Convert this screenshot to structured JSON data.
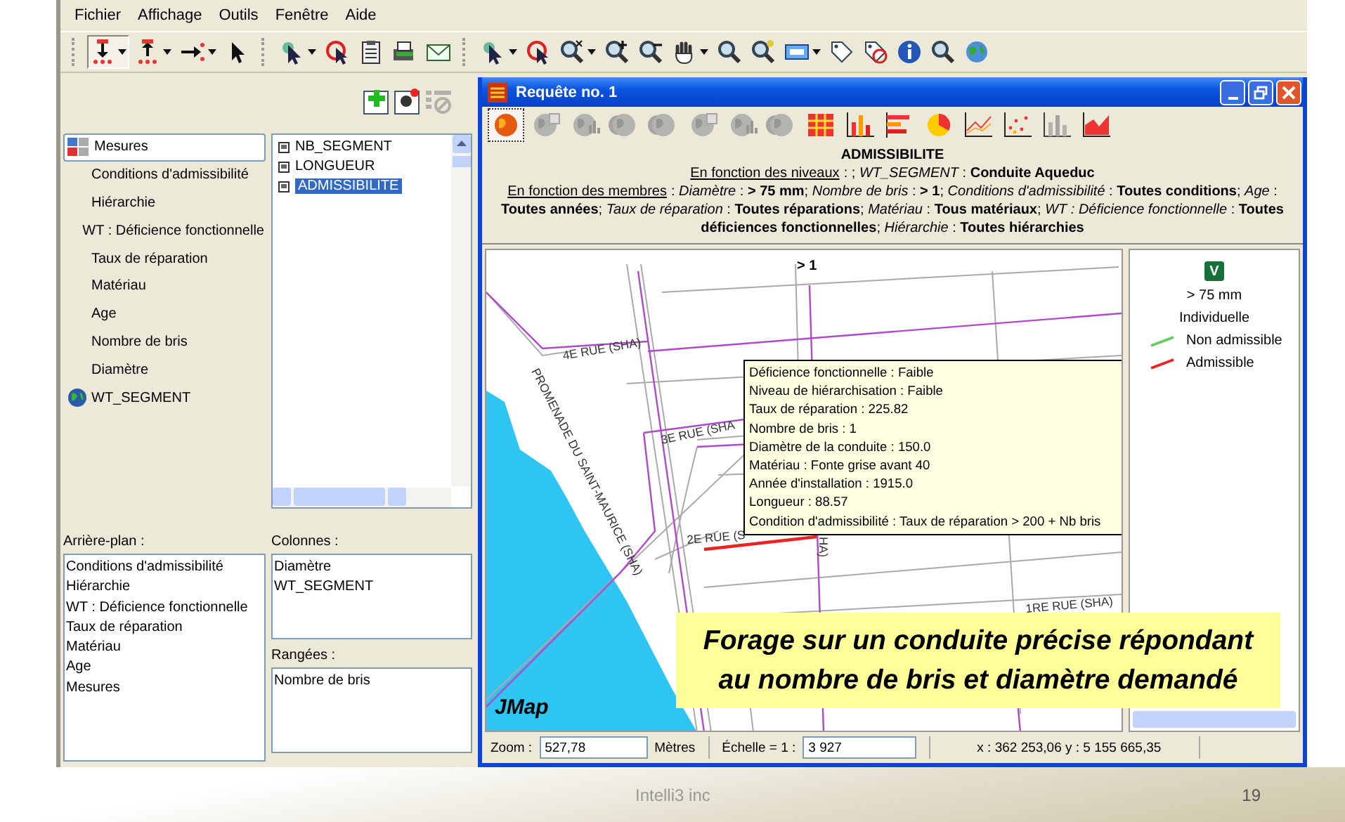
{
  "menu": [
    "Fichier",
    "Affichage",
    "Outils",
    "Fenêtre",
    "Aide"
  ],
  "toolbar": [
    [
      {
        "kind": "pin-down",
        "dropdown": true,
        "selected": true
      },
      {
        "kind": "pin-up",
        "dropdown": true,
        "selected": false
      },
      {
        "kind": "connect",
        "dropdown": true,
        "selected": false
      },
      {
        "kind": "pointer",
        "dropdown": false,
        "selected": false
      }
    ],
    [
      {
        "kind": "cursor",
        "dropdown": true,
        "selected": false
      },
      {
        "kind": "target",
        "dropdown": false,
        "selected": false
      },
      {
        "kind": "clipboard",
        "dropdown": false,
        "selected": false
      },
      {
        "kind": "printer",
        "dropdown": false,
        "selected": false
      },
      {
        "kind": "mail",
        "dropdown": false,
        "selected": false
      }
    ],
    [
      {
        "kind": "cursor",
        "dropdown": true,
        "selected": false
      },
      {
        "kind": "target",
        "dropdown": false,
        "selected": false
      },
      {
        "kind": "zoom-x",
        "dropdown": true,
        "selected": false
      },
      {
        "kind": "zoom-in",
        "dropdown": false,
        "selected": false
      },
      {
        "kind": "zoom-out",
        "dropdown": false,
        "selected": false
      },
      {
        "kind": "hand",
        "dropdown": true,
        "selected": false
      },
      {
        "kind": "zoom-back",
        "dropdown": false,
        "selected": false
      },
      {
        "kind": "zoom-point",
        "dropdown": false,
        "selected": false
      },
      {
        "kind": "scale",
        "dropdown": true,
        "selected": false
      },
      {
        "kind": "tag",
        "dropdown": false,
        "selected": false
      },
      {
        "kind": "tag-off",
        "dropdown": false,
        "selected": false
      },
      {
        "kind": "info",
        "dropdown": false,
        "selected": false
      },
      {
        "kind": "search",
        "dropdown": false,
        "selected": false
      },
      {
        "kind": "globe",
        "dropdown": false,
        "selected": false
      }
    ]
  ],
  "left_panel": {
    "tools": [
      {
        "kind": "add",
        "disabled": false
      },
      {
        "kind": "settings",
        "disabled": false
      },
      {
        "kind": "filter",
        "disabled": true
      }
    ],
    "tree": [
      {
        "label": "Mesures",
        "kind": "measures",
        "selected": true
      },
      {
        "label": "Conditions d'admissibilité",
        "kind": "dimension",
        "selected": false
      },
      {
        "label": "Hiérarchie",
        "kind": "dimension",
        "selected": false
      },
      {
        "label": "WT : Déficience fonctionnelle",
        "kind": "dimension",
        "selected": false
      },
      {
        "label": "Taux de réparation",
        "kind": "dimension",
        "selected": false
      },
      {
        "label": "Matériau",
        "kind": "dimension",
        "selected": false
      },
      {
        "label": "Age",
        "kind": "dimension",
        "selected": false
      },
      {
        "label": "Nombre de bris",
        "kind": "dimension",
        "selected": false
      },
      {
        "label": "Diamètre",
        "kind": "dimension",
        "selected": false
      },
      {
        "label": "WT_SEGMENT",
        "kind": "layer",
        "selected": false
      }
    ],
    "measures": [
      {
        "label": "NB_SEGMENT",
        "selected": false
      },
      {
        "label": "LONGUEUR",
        "selected": false
      },
      {
        "label": "ADMISSIBILITE",
        "selected": true
      }
    ],
    "background": {
      "label": "Arrière-plan :",
      "items": [
        "Conditions d'admissibilité",
        "Hiérarchie",
        "WT : Déficience fonctionnelle",
        "Taux de réparation",
        "Matériau",
        "Age",
        "Mesures"
      ]
    },
    "columns": {
      "label": "Colonnes :",
      "items": [
        "Diamètre",
        "WT_SEGMENT"
      ]
    },
    "rows": {
      "label": "Rangées :",
      "items": [
        "Nombre de bris"
      ]
    }
  },
  "window": {
    "title": "Requête no. 1",
    "chart_tools": [
      {
        "kind": "map",
        "disabled": false,
        "selected": true
      },
      {
        "kind": "map-hatch",
        "disabled": true,
        "selected": false
      },
      {
        "kind": "map-bars",
        "disabled": true,
        "selected": false
      },
      {
        "kind": "map-double",
        "disabled": true,
        "selected": false
      },
      {
        "kind": "map-double",
        "disabled": true,
        "selected": false
      },
      {
        "kind": "map-hatch",
        "disabled": true,
        "selected": false
      },
      {
        "kind": "map-bars",
        "disabled": true,
        "selected": false
      },
      {
        "kind": "map-double",
        "disabled": true,
        "selected": false
      },
      {
        "kind": "table",
        "disabled": false,
        "selected": false
      },
      {
        "kind": "bars",
        "disabled": false,
        "selected": false
      },
      {
        "kind": "hbars",
        "disabled": false,
        "selected": false
      },
      {
        "kind": "pie",
        "disabled": false,
        "selected": false
      },
      {
        "kind": "line",
        "disabled": false,
        "selected": false
      },
      {
        "kind": "scatter",
        "disabled": false,
        "selected": false
      },
      {
        "kind": "bars",
        "disabled": true,
        "selected": false
      },
      {
        "kind": "area",
        "disabled": false,
        "selected": false
      }
    ],
    "description": {
      "title": "ADMISSIBILITE",
      "lines": [
        {
          "label": "En fonction des niveaux",
          "text": ": ; *WT_SEGMENT* : **Conduite Aqueduc**"
        },
        {
          "label": "En fonction des membres",
          "text": ": *Diamètre* : **> 75 mm**; *Nombre de bris* : **> 1**; *Conditions d'admissibilité* : **Toutes conditions**; *Age* : **Toutes années**; *Taux de réparation* : **Toutes réparations**; *Matériau* : **Tous matériaux**; *WT : Déficience fonctionnelle* : **Toutes déficiences fonctionnelles**; *Hiérarchie* : **Toutes hiérarchies**"
        }
      ]
    },
    "map": {
      "column_header": "> 1",
      "streets": [
        "4E RUE (SHA)",
        "PROMENADE DU SAINT-MAURICE (SHA)",
        "3E RUE (SHA",
        "2E RUE (S",
        "HA)",
        "1RE RUE (SHA)"
      ],
      "logo": "JMap",
      "tooltip": [
        "Déficience fonctionnelle : Faible",
        "Niveau de hiérarchisation : Faible",
        "Taux de réparation : 225.82",
        "Nombre de bris : 1",
        "Diamètre de la conduite : 150.0",
        "Matériau : Fonte grise avant 40",
        "Année d'installation : 1915.0",
        "Longueur : 88.57",
        "Condition d'admissibilité : Taux de réparation > 200 + Nb bris"
      ]
    },
    "legend": {
      "badge": "V",
      "title": "> 75 mm",
      "subtitle": "Individuelle",
      "items": [
        {
          "label": "Non admissible",
          "color": "#66cc66"
        },
        {
          "label": "Admissible",
          "color": "#ee2222"
        }
      ]
    },
    "status_bar": {
      "zoom_label": "Zoom :",
      "zoom_value": "527,78",
      "zoom_unit": "Mètres",
      "scale_label": "Échelle = 1 :",
      "scale_value": "3 927",
      "coordinates": "x : 362 253,06  y : 5 155 665,35"
    }
  },
  "callout": "Forage sur un conduite précise répondant au nombre de bris et diamètre demandé",
  "footer": {
    "company": "Intelli3 inc",
    "page": "19"
  }
}
